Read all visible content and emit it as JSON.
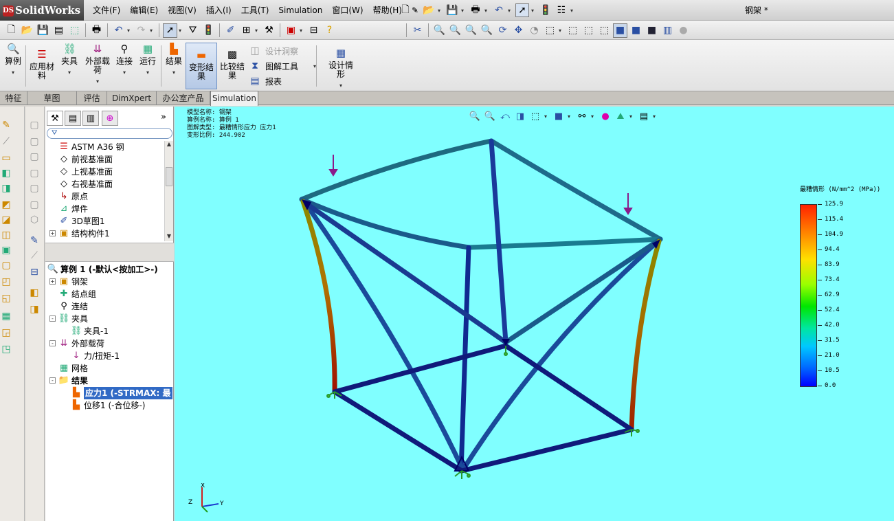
{
  "app": {
    "logo_text": "SolidWorks",
    "logo_mark": "DS",
    "document_title": "钢架 *"
  },
  "menus": [
    "文件(F)",
    "编辑(E)",
    "视图(V)",
    "插入(I)",
    "工具(T)",
    "Simulation",
    "窗口(W)",
    "帮助(H)"
  ],
  "command_manager": {
    "buttons": [
      {
        "label": "算例",
        "icon": "study-icon"
      },
      {
        "label": "应用材料",
        "icon": "apply-material-icon"
      },
      {
        "label": "夹具",
        "icon": "fixture-icon"
      },
      {
        "label": "外部载荷",
        "icon": "external-load-icon"
      },
      {
        "label": "连接",
        "icon": "connection-icon"
      },
      {
        "label": "运行",
        "icon": "run-icon"
      },
      {
        "label": "结果",
        "icon": "results-icon"
      },
      {
        "label": "变形结果",
        "icon": "deformed-result-icon"
      },
      {
        "label": "比较结果",
        "icon": "compare-results-icon"
      },
      {
        "label": "设计情形",
        "icon": "design-scenario-icon"
      }
    ],
    "small_buttons": [
      {
        "label": "设计洞察",
        "disabled": true
      },
      {
        "label": "图解工具",
        "disabled": false
      },
      {
        "label": "报表",
        "disabled": false
      }
    ]
  },
  "tabs": [
    "特征",
    "草图",
    "评估",
    "DimXpert",
    "办公室产品",
    "Simulation"
  ],
  "active_tab": "Simulation",
  "feature_tree": {
    "items": [
      {
        "label": "ASTM A36 钢",
        "icon": "material-icon"
      },
      {
        "label": "前视基准面",
        "icon": "plane-icon"
      },
      {
        "label": "上视基准面",
        "icon": "plane-icon"
      },
      {
        "label": "右视基准面",
        "icon": "plane-icon"
      },
      {
        "label": "原点",
        "icon": "origin-icon"
      },
      {
        "label": "焊件",
        "icon": "weldment-icon"
      },
      {
        "label": "3D草图1",
        "icon": "sketch3d-icon"
      },
      {
        "label": "结构构件1",
        "icon": "structural-member-icon"
      }
    ]
  },
  "study_tree": {
    "title": "算例 1 (-默认<按加工>-)",
    "items": [
      {
        "label": "钢架",
        "indent": 1,
        "expander": "+"
      },
      {
        "label": "结点组",
        "indent": 1,
        "expander": ""
      },
      {
        "label": "连结",
        "indent": 1,
        "expander": ""
      },
      {
        "label": "夹具",
        "indent": 1,
        "expander": "-"
      },
      {
        "label": "夹具-1",
        "indent": 2,
        "expander": ""
      },
      {
        "label": "外部载荷",
        "indent": 1,
        "expander": "-"
      },
      {
        "label": "力/扭矩-1",
        "indent": 2,
        "expander": ""
      },
      {
        "label": "网格",
        "indent": 1,
        "expander": ""
      },
      {
        "label": "结果",
        "indent": 1,
        "expander": "-",
        "bold": true
      },
      {
        "label": "应力1 (-STRMAX: 最",
        "indent": 2,
        "expander": "",
        "selected": true
      },
      {
        "label": "位移1 (-合位移-)",
        "indent": 2,
        "expander": ""
      }
    ]
  },
  "viewport_info": [
    "模型名称: 钢架",
    "算例名称: 算例 1",
    "图解类型: 最糟情形应力 应力1",
    "变形比例: 244.902"
  ],
  "legend": {
    "title": "最糟情形 (N/mm^2 (MPa))",
    "values": [
      "125.9",
      "115.4",
      "104.9",
      "94.4",
      "83.9",
      "73.4",
      "62.9",
      "52.4",
      "42.0",
      "31.5",
      "21.0",
      "10.5",
      "0.0"
    ]
  },
  "triad_labels": {
    "x": "X",
    "y": "Y",
    "z": "Z"
  },
  "colors": {
    "viewport_bg": "#80ffff",
    "selection": "#316ac5"
  }
}
